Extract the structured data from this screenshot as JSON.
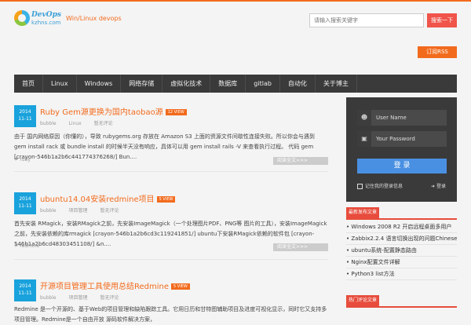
{
  "header": {
    "logo_top": "DevOps",
    "logo_bottom": "kzhns.com",
    "tagline": "Win/Linux devops",
    "search_placeholder": "请输入搜索关键字",
    "search_button": "搜索一下",
    "rss_label": "订阅RSS"
  },
  "nav": [
    "首页",
    "Linux",
    "Windows",
    "网络存储",
    "虚拟化技术",
    "数据库",
    "gitlab",
    "自动化",
    "关于博主"
  ],
  "posts": [
    {
      "year": "2014",
      "date": "11-11",
      "title": "Ruby Gem源更换为国内taobao源",
      "views": "12 VIEW",
      "author": "bubble",
      "category": "Linux",
      "comments": "暂无评论",
      "excerpt": "由于 国内网络原因（你懂的），导致 rubygems.org 存放在 Amazon S3 上面的资源文件间歇性连接失败。所以你会与遇到 gem install rack 或 bundle install 的时候半天没有响应，具体可以用 gem install rails -V 来查看执行过程。 代码 gem [crayon-546b1a2b6c441774376268/]   Bun....",
      "tag": "ruby",
      "readmore": "阅读全文>>>"
    },
    {
      "year": "2014",
      "date": "11-11",
      "title": "ubuntu14.04安装redmine项目",
      "views": "5 VIEW",
      "author": "bubble",
      "category": "项目管理",
      "comments": "暂无评论",
      "excerpt": "首先安装 RMagick，安装RMagick之前，先安装ImageMagick（一个处理图片PDF、PNG等 图片的工具），安装ImageMagick之前，先安装依赖的库rmagick [crayon-546b1a2b6cd3c119241851/] ubuntu下安装RMagick依赖的软件包 [crayon-546b1a2b6cd48303451108/]   &n....",
      "tag": "redmine",
      "readmore": "阅读全文>>>"
    },
    {
      "year": "2014",
      "date": "11-11",
      "title": "开源项目管理工具使用总结Redmine",
      "views": "5 VIEW",
      "author": "bubble",
      "category": "项目管理",
      "comments": "暂无评论",
      "excerpt": "Redmine 是一个开源的、基于Web的项目管理和缺陷跟踪工具。它用日历和甘特图辅助项目及进度可视化显示，同时它又支持多项目管理。Redmine是一个自由开放 源码软件解决方案，",
      "tag": "",
      "readmore": "阅读全文>>>"
    }
  ],
  "login": {
    "username": "User Name",
    "password": "Your Password",
    "button": "登 录",
    "remember": "记住我的登录信息",
    "signin": "登录"
  },
  "widgets": {
    "recent_title": "最新发布文章",
    "recent_items": [
      "Windows 2008 R2 开启远程桌面多用户",
      "Zabbix2.2.4 语言切换出现的问题Chinese(zh_CN)",
      "ubuntu系统-配置静态路由",
      "Nginx配置文件详解",
      "Python3 list方法"
    ],
    "second_title": "热门评论文章"
  },
  "colors": {
    "accent": "#f26b1d",
    "date_blue": "#19a2dc",
    "nav_bg": "#3a3a3a",
    "widget_red": "#e74c3c",
    "login_blue": "#4a90e2"
  }
}
